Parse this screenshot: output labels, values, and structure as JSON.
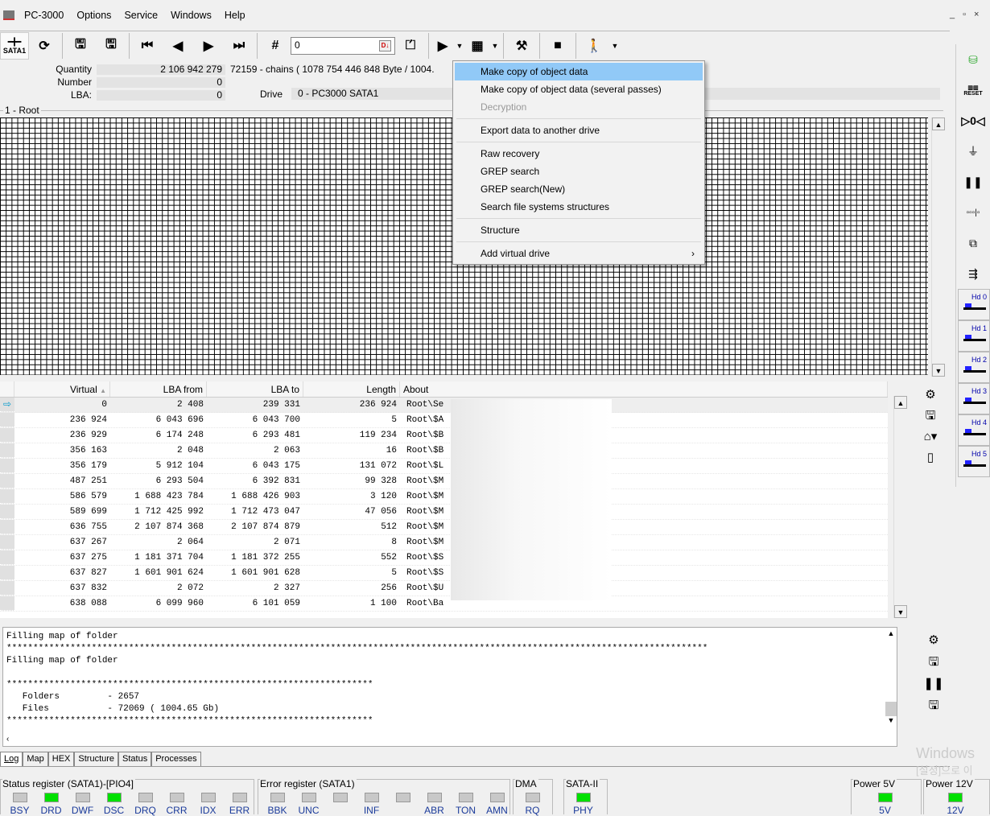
{
  "app": {
    "title": "PC-3000",
    "menu": [
      "Options",
      "Service",
      "Windows",
      "Help"
    ],
    "window_controls": [
      "_",
      "▫",
      "×"
    ]
  },
  "toolbar": {
    "sata_label": "SATA1",
    "number_input": "0",
    "number_btn": "D↓"
  },
  "info": {
    "quantity_label": "Quantity",
    "quantity_value": "2 106 942 279",
    "quantity_extra": "72159 - chains  ( 1078 754 446 848 Byte /  1004.",
    "number_label": "Number",
    "number_value": "0",
    "lba_label": "LBA:",
    "lba_value": "0",
    "drive_label": "Drive",
    "drive_value": "0 - PC3000 SATA1"
  },
  "map": {
    "title": "1 - Root"
  },
  "context_menu": {
    "items": [
      {
        "label": "Make copy of object data",
        "state": "selected"
      },
      {
        "label": "Make copy of object data (several passes)"
      },
      {
        "label": "Decryption",
        "state": "disabled"
      },
      {
        "sep": true
      },
      {
        "label": "Export data to another drive"
      },
      {
        "sep": true
      },
      {
        "label": "Raw recovery"
      },
      {
        "label": "GREP search"
      },
      {
        "label": "GREP search(New)"
      },
      {
        "label": "Search file systems structures"
      },
      {
        "sep": true
      },
      {
        "label": "Structure"
      },
      {
        "sep": true
      },
      {
        "label": "Add virtual drive",
        "submenu": true
      }
    ]
  },
  "table": {
    "columns": [
      "Virtual",
      "LBA from",
      "LBA to",
      "Length",
      "About"
    ],
    "sort_indicator": "▲",
    "rows": [
      [
        "0",
        "2 408",
        "239 331",
        "236 924",
        "Root\\Se"
      ],
      [
        "236 924",
        "6 043 696",
        "6 043 700",
        "5",
        "Root\\$A"
      ],
      [
        "236 929",
        "6 174 248",
        "6 293 481",
        "119 234",
        "Root\\$B"
      ],
      [
        "356 163",
        "2 048",
        "2 063",
        "16",
        "Root\\$B"
      ],
      [
        "356 179",
        "5 912 104",
        "6 043 175",
        "131 072",
        "Root\\$L"
      ],
      [
        "487 251",
        "6 293 504",
        "6 392 831",
        "99 328",
        "Root\\$M"
      ],
      [
        "586 579",
        "1 688 423 784",
        "1 688 426 903",
        "3 120",
        "Root\\$M"
      ],
      [
        "589 699",
        "1 712 425 992",
        "1 712 473 047",
        "47 056",
        "Root\\$M"
      ],
      [
        "636 755",
        "2 107 874 368",
        "2 107 874 879",
        "512",
        "Root\\$M"
      ],
      [
        "637 267",
        "2 064",
        "2 071",
        "8",
        "Root\\$M"
      ],
      [
        "637 275",
        "1 181 371 704",
        "1 181 372 255",
        "552",
        "Root\\$S"
      ],
      [
        "637 827",
        "1 601 901 624",
        "1 601 901 628",
        "5",
        "Root\\$S"
      ],
      [
        "637 832",
        "2 072",
        "2 327",
        "256",
        "Root\\$U"
      ],
      [
        "638 088",
        "6 099 960",
        "6 101 059",
        "1 100",
        "Root\\Ba"
      ]
    ]
  },
  "log": {
    "lines": [
      "Filling map of folder",
      "************************************************************************************************************************************",
      "Filling map of folder",
      "",
      "*********************************************************************",
      "   Folders         - 2657",
      "   Files           - 72069 ( 1004.65 Gb)",
      "*********************************************************************"
    ]
  },
  "tabs": [
    "Log",
    "Map",
    "HEX",
    "Structure",
    "Status",
    "Processes"
  ],
  "status": {
    "status_reg": {
      "title": "Status register (SATA1)-[PIO4]",
      "leds": [
        [
          "BSY",
          0
        ],
        [
          "DRD",
          1
        ],
        [
          "DWF",
          0
        ],
        [
          "DSC",
          1
        ],
        [
          "DRQ",
          0
        ],
        [
          "CRR",
          0
        ],
        [
          "IDX",
          0
        ],
        [
          "ERR",
          0
        ]
      ]
    },
    "error_reg": {
      "title": "Error register (SATA1)",
      "leds": [
        [
          "BBK",
          0
        ],
        [
          "UNC",
          0
        ],
        [
          "",
          0
        ],
        [
          "INF",
          0
        ],
        [
          "",
          0
        ],
        [
          "ABR",
          0
        ],
        [
          "TON",
          0
        ],
        [
          "AMN",
          0
        ]
      ]
    },
    "dma": {
      "title": "DMA",
      "leds": [
        [
          "RQ",
          0
        ]
      ]
    },
    "sata": {
      "title": "SATA-II",
      "leds": [
        [
          "PHY",
          1
        ]
      ]
    },
    "p5": {
      "title": "Power 5V",
      "leds": [
        [
          "5V",
          1
        ]
      ]
    },
    "p12": {
      "title": "Power 12V",
      "leds": [
        [
          "12V",
          1
        ]
      ]
    }
  },
  "right_panel": {
    "heads": [
      "Hd 0",
      "Hd 1",
      "Hd 2",
      "Hd 3",
      "Hd 4",
      "Hd 5"
    ],
    "reset_label": "RESET"
  },
  "watermark": [
    "Windows",
    "[설정]으로 이"
  ]
}
